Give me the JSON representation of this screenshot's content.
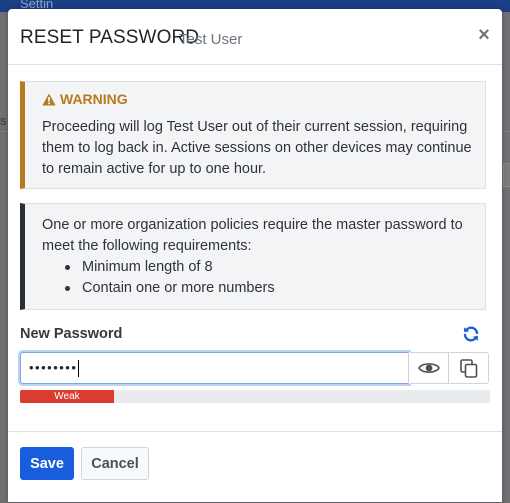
{
  "background": {
    "header_partial_text": "Settin",
    "left_partial_char": "s"
  },
  "modal": {
    "title": "RESET PASSWORD",
    "subtitle": "Test User",
    "close_symbol": "×"
  },
  "warning": {
    "title": "WARNING",
    "icon": "warning-triangle-icon",
    "body": "Proceeding will log Test User out of their current session, requiring them to log back in. Active sessions on other devices may continue to remain active for up to one hour."
  },
  "policy": {
    "intro": "One or more organization policies require the master password to meet the following requirements:",
    "requirements": [
      "Minimum length of 8",
      "Contain one or more numbers"
    ]
  },
  "password": {
    "label": "New Password",
    "masked_value": "••••••••",
    "strength_label": "Weak",
    "strength_fraction": 0.2,
    "regenerate_icon": "refresh-icon",
    "toggle_icon": "eye-icon",
    "copy_icon": "copy-icon"
  },
  "footer": {
    "save_label": "Save",
    "cancel_label": "Cancel"
  },
  "colors": {
    "accent": "#175ddc",
    "warning": "#b7791f",
    "weak": "#dc3b2f"
  }
}
